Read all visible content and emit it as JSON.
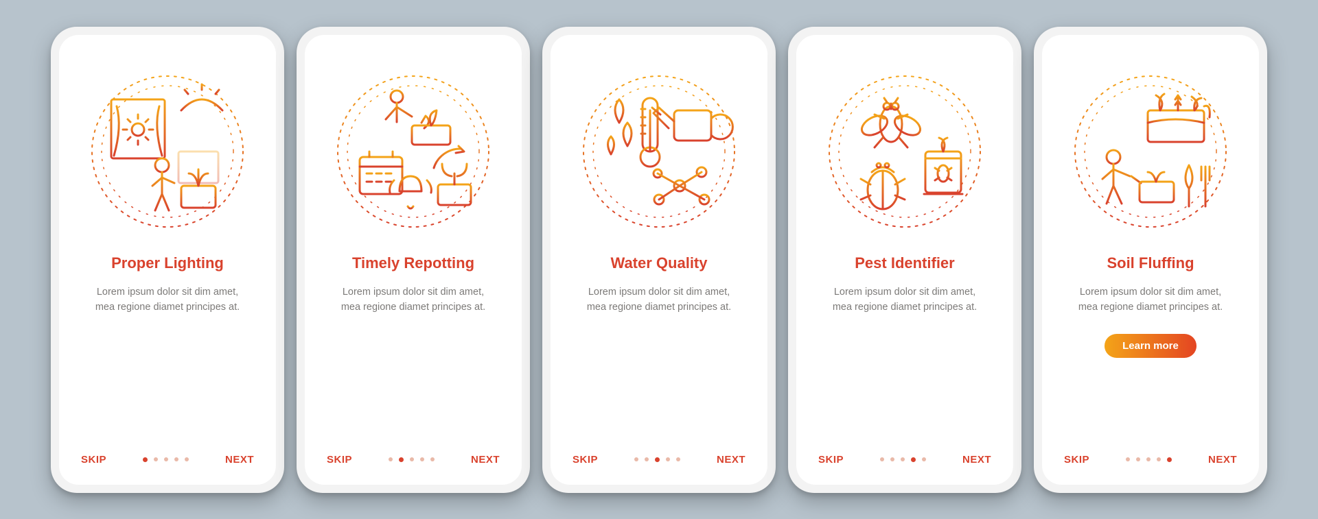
{
  "colors": {
    "accent": "#d9422d",
    "text_muted": "#7c7a78",
    "phone_bg": "#f3f3f3",
    "page_bg": "#b7c3cc"
  },
  "common": {
    "skip_label": "SKIP",
    "next_label": "NEXT",
    "dots_total": 5,
    "lorem": "Lorem ipsum dolor sit dim amet, mea regione diamet principes at."
  },
  "screens": [
    {
      "title": "Proper Lighting",
      "icon": "lighting-icon",
      "active_dot": 0,
      "has_cta": false
    },
    {
      "title": "Timely Repotting",
      "icon": "repotting-icon",
      "active_dot": 1,
      "has_cta": false
    },
    {
      "title": "Water Quality",
      "icon": "water-icon",
      "active_dot": 2,
      "has_cta": false
    },
    {
      "title": "Pest Identifier",
      "icon": "pest-icon",
      "active_dot": 3,
      "has_cta": false
    },
    {
      "title": "Soil Fluffing",
      "icon": "soil-icon",
      "active_dot": 4,
      "has_cta": true,
      "cta_label": "Learn more"
    }
  ]
}
